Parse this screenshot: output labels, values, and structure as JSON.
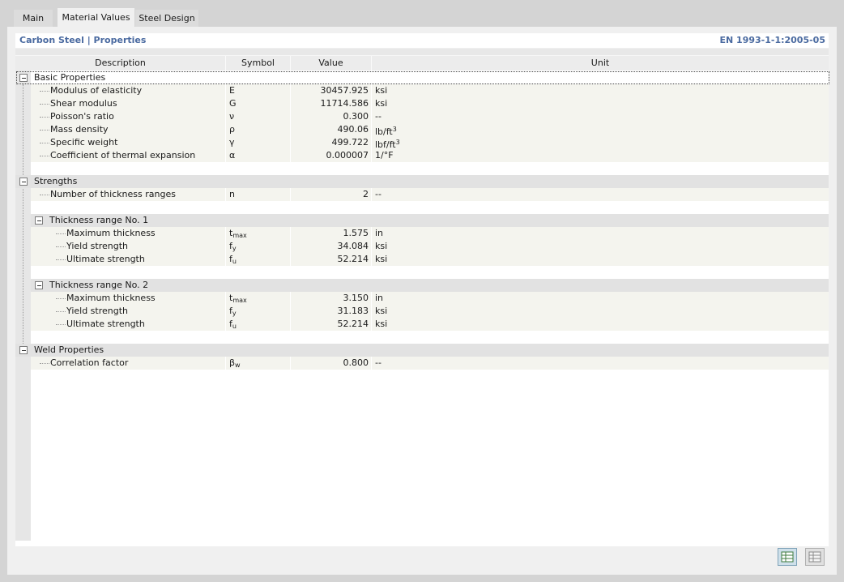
{
  "tabs": [
    {
      "label": "Main"
    },
    {
      "label": "Material Values"
    },
    {
      "label": "Steel Design"
    }
  ],
  "header": {
    "title": "Carbon Steel | Properties",
    "standard": "EN 1993-1-1:2005-05"
  },
  "columns": {
    "description": "Description",
    "symbol": "Symbol",
    "value": "Value",
    "unit": "Unit"
  },
  "groups": {
    "basic": "Basic Properties",
    "strengths": "Strengths",
    "range1": "Thickness range No. 1",
    "range2": "Thickness range No. 2",
    "weld": "Weld Properties"
  },
  "basic_rows": [
    {
      "desc": "Modulus of elasticity",
      "sym": "E",
      "val": "30457.925",
      "unit": "ksi"
    },
    {
      "desc": "Shear modulus",
      "sym": "G",
      "val": "11714.586",
      "unit": "ksi"
    },
    {
      "desc": "Poisson's ratio",
      "sym": "ν",
      "val": "0.300",
      "unit": "--"
    },
    {
      "desc": "Mass density",
      "sym": "ρ",
      "val": "490.06",
      "unit_base": "lb/ft",
      "unit_sup": "3"
    },
    {
      "desc": "Specific weight",
      "sym": "γ",
      "val": "499.722",
      "unit_base": "lbf/ft",
      "unit_sup": "3"
    },
    {
      "desc": "Coefficient of thermal expansion",
      "sym": "α",
      "val": "0.000007",
      "unit": "1/°F"
    }
  ],
  "strength_rows": [
    {
      "desc": "Number of thickness ranges",
      "sym": "n",
      "val": "2",
      "unit": "--"
    }
  ],
  "range1_rows": [
    {
      "desc": "Maximum thickness",
      "sym_base": "t",
      "sym_sub": "max",
      "val": "1.575",
      "unit": "in"
    },
    {
      "desc": "Yield strength",
      "sym_base": "f",
      "sym_sub": "y",
      "val": "34.084",
      "unit": "ksi"
    },
    {
      "desc": "Ultimate strength",
      "sym_base": "f",
      "sym_sub": "u",
      "val": "52.214",
      "unit": "ksi"
    }
  ],
  "range2_rows": [
    {
      "desc": "Maximum thickness",
      "sym_base": "t",
      "sym_sub": "max",
      "val": "3.150",
      "unit": "in"
    },
    {
      "desc": "Yield strength",
      "sym_base": "f",
      "sym_sub": "y",
      "val": "31.183",
      "unit": "ksi"
    },
    {
      "desc": "Ultimate strength",
      "sym_base": "f",
      "sym_sub": "u",
      "val": "52.214",
      "unit": "ksi"
    }
  ],
  "weld_rows": [
    {
      "desc": "Correlation factor",
      "sym_base": "β",
      "sym_sub": "w",
      "val": "0.800",
      "unit": "--"
    }
  ],
  "icons": {
    "footer_primary": "table-export-icon",
    "footer_secondary": "table-view-icon"
  },
  "colors": {
    "header_text": "#4a6aa0",
    "row_band": "#f4f4ee",
    "group_band": "#e2e2e2"
  }
}
